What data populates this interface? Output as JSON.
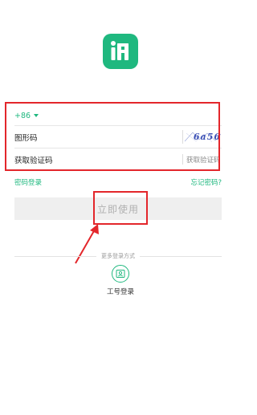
{
  "logo": {
    "icon": "app-logo-icon",
    "color": "#1fb87f"
  },
  "form": {
    "phone": {
      "country_code": "+86"
    },
    "captcha": {
      "label": "图形码",
      "image_text": "6a56"
    },
    "sms_code": {
      "label": "获取验证码",
      "get_code_label": "获取验证码"
    }
  },
  "links": {
    "password_login": "密码登录",
    "forgot_password": "忘记密码?"
  },
  "submit": {
    "label": "立即使用"
  },
  "more_login": {
    "title": "更多登录方式",
    "options": [
      {
        "label": "工号登录",
        "icon": "id-card-icon"
      }
    ]
  },
  "colors": {
    "accent": "#1fb87f",
    "annotation_red": "#e3262b",
    "button_bg": "#efefef"
  }
}
